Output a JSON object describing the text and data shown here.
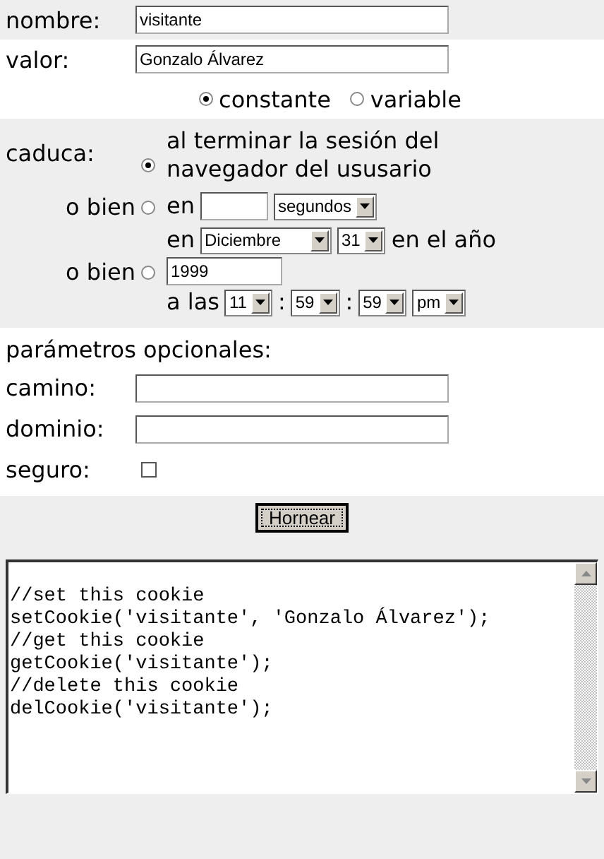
{
  "fields": [
    {
      "label": "nombre:",
      "value": "visitante"
    },
    {
      "label": "valor:",
      "value": "Gonzalo Álvarez"
    }
  ],
  "value_type": [
    {
      "label": "constante",
      "selected": true
    },
    {
      "label": "variable",
      "selected": false
    }
  ],
  "expiry": {
    "label": "caduca:",
    "options": [
      {
        "selected": true,
        "lines": [
          [
            {
              "kind": "text",
              "text": "al terminar la sesión del navegador del ususario"
            }
          ]
        ]
      },
      {
        "prefix": "o bien",
        "selected": false,
        "lines": [
          [
            {
              "kind": "text",
              "text": "en"
            },
            {
              "kind": "input"
            },
            {
              "kind": "select",
              "value": "segundos"
            }
          ]
        ]
      },
      {
        "prefix": "o bien",
        "selected": false,
        "lines": [
          [
            {
              "kind": "text",
              "text": "en"
            },
            {
              "kind": "select",
              "value": "Diciembre"
            },
            {
              "kind": "select",
              "value": "31"
            },
            {
              "kind": "text",
              "text": "en el año"
            }
          ],
          [
            {
              "kind": "input",
              "value": "1999"
            }
          ],
          [
            {
              "kind": "text",
              "text": "a las"
            },
            {
              "kind": "select",
              "value": "11"
            },
            {
              "kind": "text",
              "text": ":"
            },
            {
              "kind": "select",
              "value": "59"
            },
            {
              "kind": "text",
              "text": ":"
            },
            {
              "kind": "select",
              "value": "59"
            },
            {
              "kind": "select",
              "value": "pm"
            }
          ]
        ]
      }
    ]
  },
  "optional": {
    "heading": "parámetros opcionales:",
    "fields": [
      {
        "label": "camino:",
        "kind": "text"
      },
      {
        "label": "dominio:",
        "kind": "text"
      },
      {
        "label": "seguro:",
        "kind": "checkbox",
        "checked": false
      }
    ]
  },
  "submit": "Hornear",
  "code": [
    "//set this cookie",
    "setCookie('visitante', 'Gonzalo Álvarez');",
    "//get this cookie",
    "getCookie('visitante');",
    "//delete this cookie",
    "delCookie('visitante');"
  ]
}
